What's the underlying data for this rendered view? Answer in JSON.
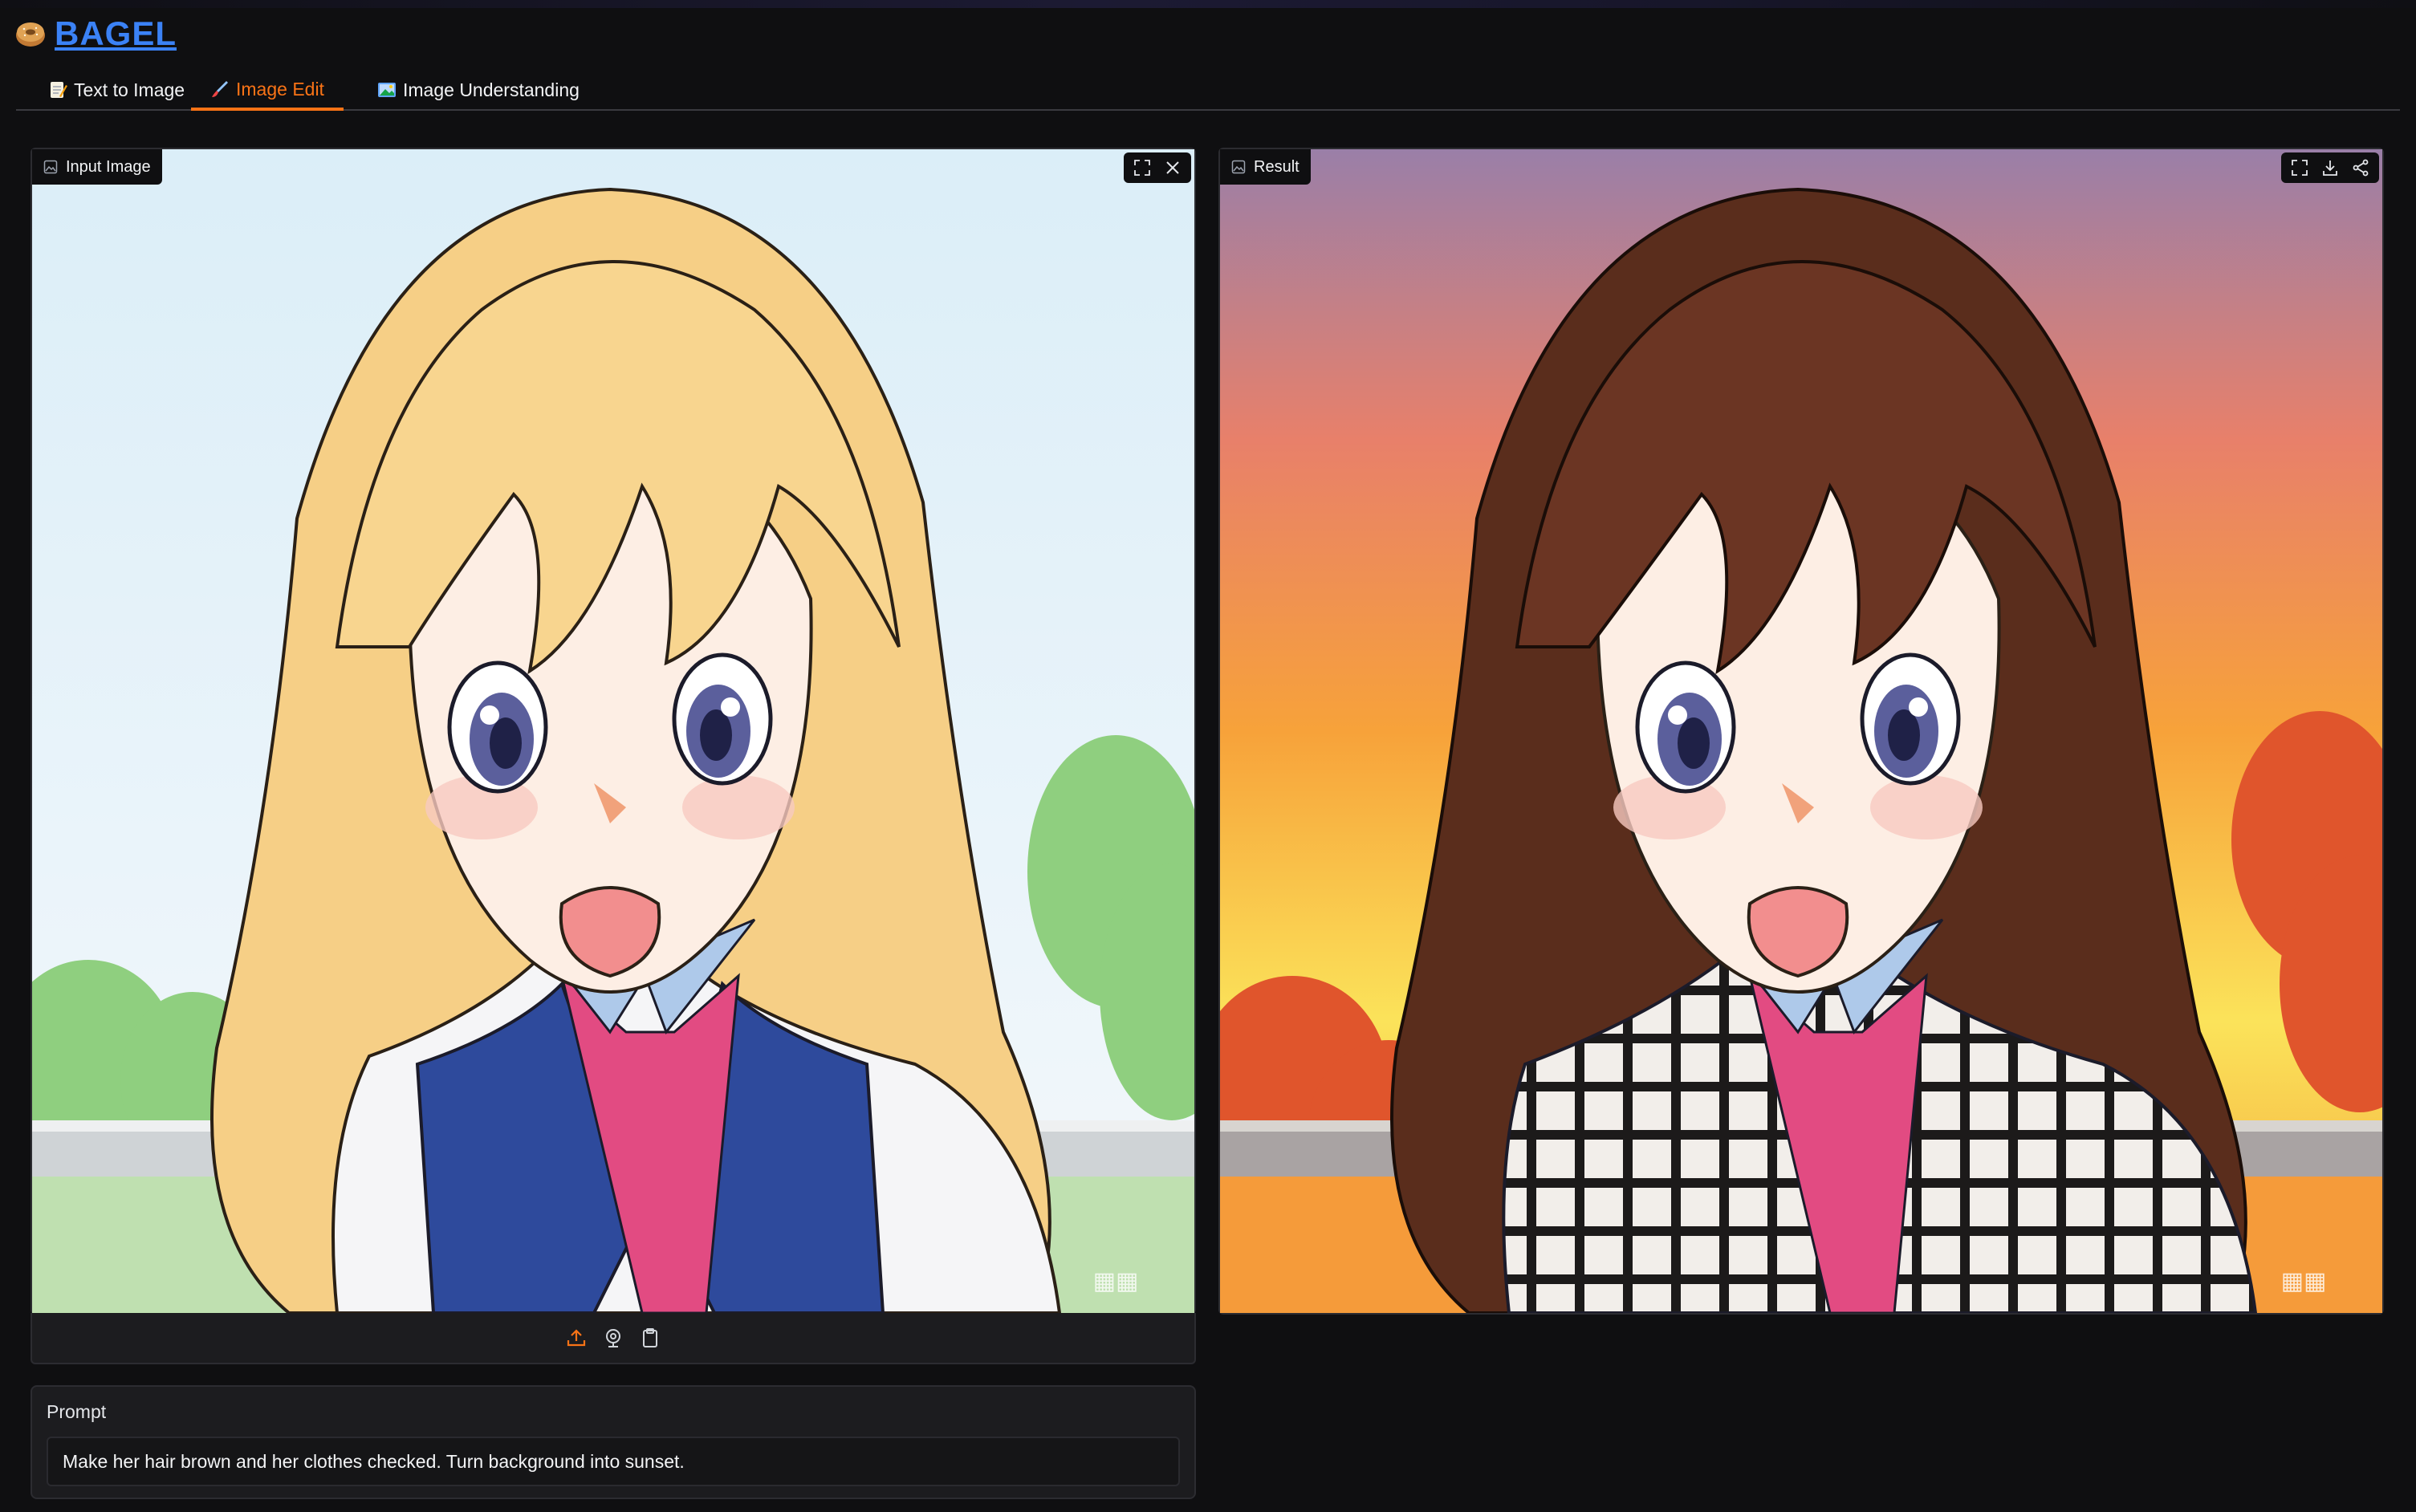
{
  "app": {
    "title": "BAGEL"
  },
  "tabs": [
    {
      "label": "Text to Image",
      "icon": "memo-icon"
    },
    {
      "label": "Image Edit",
      "icon": "paintbrush-icon",
      "active": true
    },
    {
      "label": "Image Understanding",
      "icon": "picture-icon"
    }
  ],
  "input_panel": {
    "label": "Input Image"
  },
  "result_panel": {
    "label": "Result"
  },
  "prompt": {
    "label": "Prompt",
    "value": "Make her hair brown and her clothes checked. Turn background into sunset."
  },
  "colors": {
    "accent": "#f97316",
    "brand": "#3b82f6",
    "background": "#0f0f11"
  }
}
